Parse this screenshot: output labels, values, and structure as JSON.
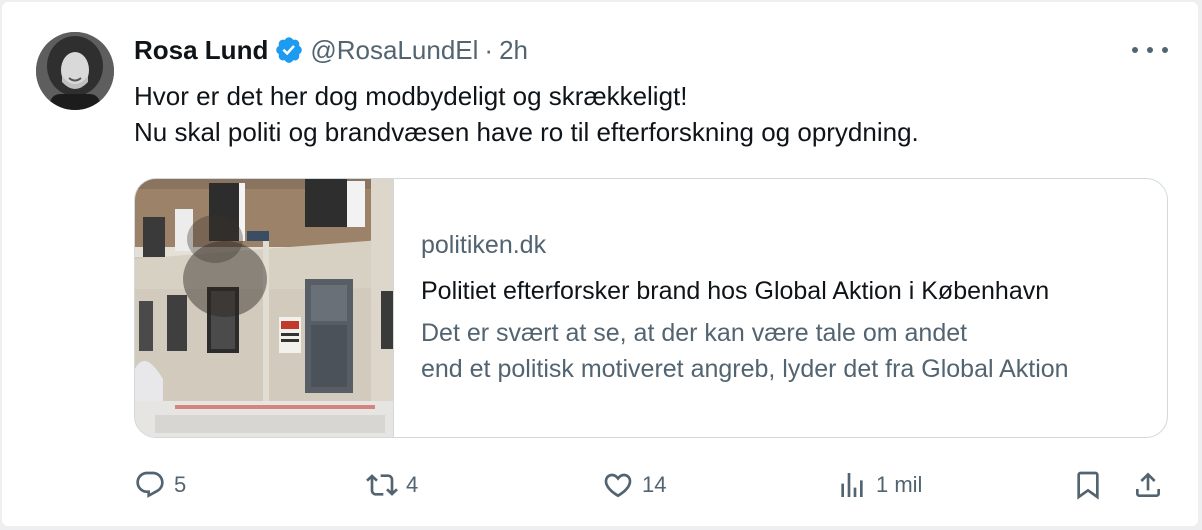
{
  "author": {
    "name": "Rosa Lund",
    "handle": "@RosaLundEl",
    "separator": "·",
    "time": "2h"
  },
  "tweet": {
    "lines": [
      "Hvor er det her dog modbydeligt og skrækkeligt!",
      "Nu skal politi og brandvæsen have ro til efterforskning og oprydning."
    ]
  },
  "card": {
    "domain": "politiken.dk",
    "title": "Politiet efterforsker brand hos Global Aktion i København",
    "description_lines": [
      "Det er svært at se, at der kan være tale om andet",
      "end et politisk motiveret angreb, lyder det fra Global Aktion"
    ],
    "image_icon": "building-photo"
  },
  "actions": {
    "replies": "5",
    "reposts": "4",
    "likes": "14",
    "views": "1 mil"
  },
  "icons": {
    "verified": "verified-badge-icon",
    "more": "more-icon",
    "reply": "reply-icon",
    "repost": "repost-icon",
    "like": "heart-icon",
    "views": "analytics-icon",
    "bookmark": "bookmark-icon",
    "share": "share-icon"
  },
  "colors": {
    "verified": "#1d9bf0",
    "text": "#0f1419",
    "secondary": "#536471",
    "border": "#cfd9de"
  }
}
